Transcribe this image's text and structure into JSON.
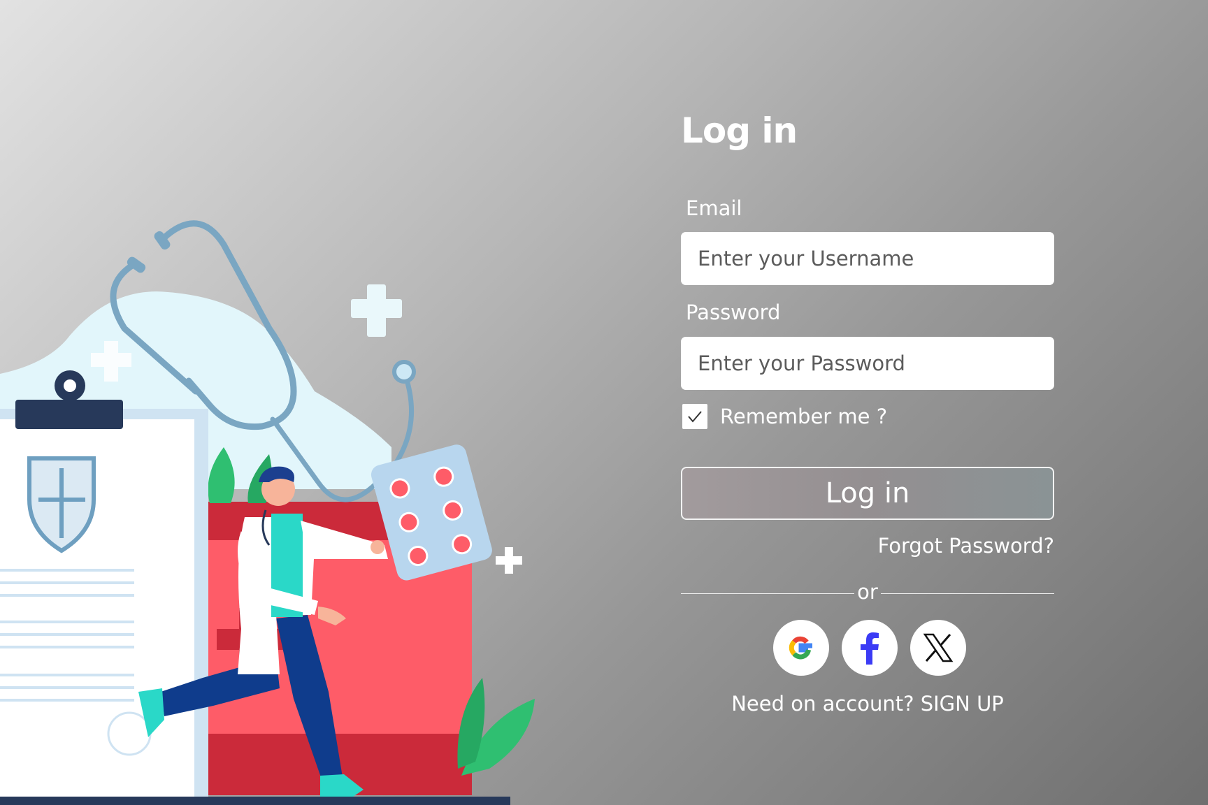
{
  "login": {
    "title": "Log in",
    "email_label": "Email",
    "email_placeholder": "Enter your Username",
    "password_label": "Password",
    "password_placeholder": "Enter your Password",
    "remember_label": "Remember me ?",
    "remember_checked": true,
    "submit_label": "Log in",
    "forgot_label": "Forgot Password?",
    "divider_text": "or",
    "signup_prefix": "Need on account?",
    "signup_link": "SIGN UP"
  },
  "social": [
    {
      "icon": "google-icon"
    },
    {
      "icon": "facebook-icon",
      "color": "#3b3bf5"
    },
    {
      "icon": "x-icon"
    }
  ],
  "colors": {
    "medical_red": "#fe5c68",
    "medical_red_dark": "#cb2a3a",
    "navy": "#27395a",
    "teal": "#2ad8c8",
    "leaf_green": "#2fbf71",
    "light_blue": "#e2f6fb"
  }
}
